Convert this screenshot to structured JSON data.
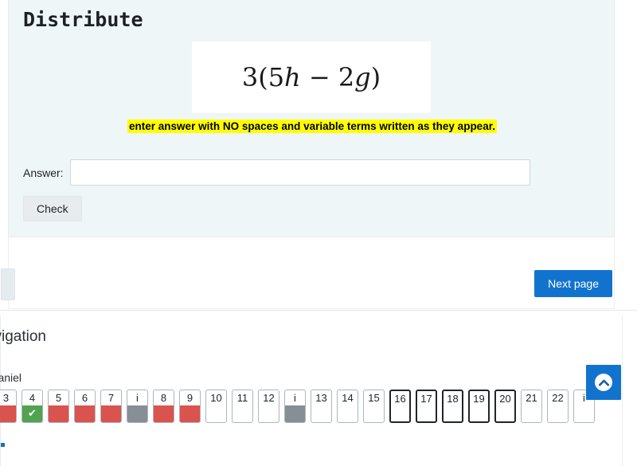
{
  "question": {
    "title": "Distribute",
    "formula_prefix": "3(5",
    "formula_var1": "h",
    "formula_middle": " − 2",
    "formula_var2": "g",
    "formula_suffix": ")",
    "formula_plain": "3(5h − 2g)",
    "hint": "enter answer with NO spaces and variable terms written as they appear.",
    "answer_label": "Answer:",
    "answer_value": "",
    "answer_placeholder": "",
    "check_label": "Check"
  },
  "navigation": {
    "next_page_label": "Next page",
    "prev_page_label": ""
  },
  "lower": {
    "clipped_heading": "Quiz navigation",
    "clipped_subtext": "Gia McDaniel",
    "blocks": [
      {
        "label": "3",
        "state": "incorrect",
        "current": false
      },
      {
        "label": "4",
        "state": "correct",
        "current": false,
        "mark": "✔"
      },
      {
        "label": "5",
        "state": "incorrect",
        "current": false
      },
      {
        "label": "6",
        "state": "incorrect",
        "current": false
      },
      {
        "label": "7",
        "state": "incorrect",
        "current": false
      },
      {
        "label": "i",
        "state": "info",
        "current": false
      },
      {
        "label": "8",
        "state": "incorrect",
        "current": false
      },
      {
        "label": "9",
        "state": "incorrect",
        "current": false
      },
      {
        "label": "10",
        "state": "blank",
        "current": false
      },
      {
        "label": "11",
        "state": "blank",
        "current": false
      },
      {
        "label": "12",
        "state": "blank",
        "current": false
      },
      {
        "label": "i",
        "state": "info",
        "current": false
      },
      {
        "label": "13",
        "state": "blank",
        "current": false
      },
      {
        "label": "14",
        "state": "blank",
        "current": false
      },
      {
        "label": "15",
        "state": "blank",
        "current": false
      },
      {
        "label": "16",
        "state": "blank",
        "current": true
      },
      {
        "label": "17",
        "state": "blank",
        "current": true
      },
      {
        "label": "18",
        "state": "blank",
        "current": true
      },
      {
        "label": "19",
        "state": "blank",
        "current": true
      },
      {
        "label": "20",
        "state": "blank",
        "current": true
      },
      {
        "label": "21",
        "state": "blank",
        "current": false
      },
      {
        "label": "22",
        "state": "blank",
        "current": false
      },
      {
        "label": "i",
        "state": "blank",
        "current": false
      }
    ]
  },
  "floating": {
    "scroll_top_icon": "chevron-up-icon"
  },
  "colors": {
    "panel_bg": "#eff6f8",
    "primary_button": "#1273cf",
    "correct": "#51a351",
    "incorrect": "#d9534f",
    "info": "#868e96",
    "highlight": "#ffff00"
  }
}
